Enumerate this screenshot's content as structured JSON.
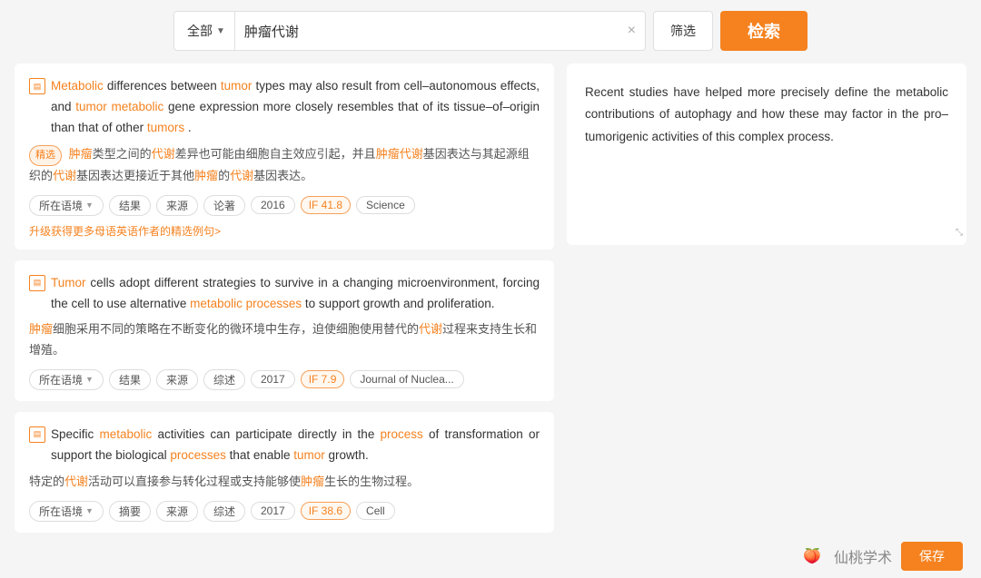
{
  "search": {
    "select_label": "全部",
    "query": "肿瘤代谢",
    "clear_icon": "×",
    "filter_label": "筛选",
    "search_label": "检索"
  },
  "results": [
    {
      "id": 1,
      "en_parts": [
        {
          "text": "Metabolic",
          "type": "orange"
        },
        {
          "text": " differences between ",
          "type": "normal"
        },
        {
          "text": "tumor",
          "type": "orange"
        },
        {
          "text": " types may also result from cell–autonomous effects, and ",
          "type": "normal"
        },
        {
          "text": "tumor",
          "type": "orange"
        },
        {
          "text": " ",
          "type": "normal"
        },
        {
          "text": "metabolic",
          "type": "orange"
        },
        {
          "text": " gene expression more closely resembles that of its tissue–of–origin than that of other ",
          "type": "normal"
        },
        {
          "text": "tumors",
          "type": "orange"
        },
        {
          "text": ".",
          "type": "normal"
        }
      ],
      "zh_prefix": "精选",
      "zh_text": "肿瘤类型之间的代谢差异也可能由细胞自主效应引起，并且肿瘤代谢基因表达与其起源组织的代谢基因表达更接近于其他肿瘤的代谢基因表达。",
      "zh_highlights": [
        "肿瘤",
        "代谢",
        "肿瘤代谢",
        "代谢",
        "肿瘤",
        "代谢"
      ],
      "tags": [
        {
          "label": "所在语境",
          "type": "dropdown"
        },
        {
          "label": "结果",
          "type": "normal"
        },
        {
          "label": "来源",
          "type": "normal"
        },
        {
          "label": "论著",
          "type": "normal"
        },
        {
          "label": "2016",
          "type": "normal"
        },
        {
          "label": "IF 41.8",
          "type": "if"
        },
        {
          "label": "Science",
          "type": "normal"
        }
      ],
      "upgrade_link": "升级获得更多母语英语作者的精选例句>"
    },
    {
      "id": 2,
      "en_parts": [
        {
          "text": "Tumor",
          "type": "orange"
        },
        {
          "text": " cells adopt different strategies to survive in a changing microenvironment, forcing the cell to use alternative ",
          "type": "normal"
        },
        {
          "text": "metabolic processes",
          "type": "orange"
        },
        {
          "text": " to support growth and proliferation.",
          "type": "normal"
        }
      ],
      "zh_text": "肿瘤细胞采用不同的策略在不断变化的微环境中生存，迫使细胞使用替代的代谢过程来支持生长和增殖。",
      "zh_highlights": [
        "肿瘤",
        "代谢"
      ],
      "tags": [
        {
          "label": "所在语境",
          "type": "dropdown"
        },
        {
          "label": "结果",
          "type": "normal"
        },
        {
          "label": "来源",
          "type": "normal"
        },
        {
          "label": "综述",
          "type": "normal"
        },
        {
          "label": "2017",
          "type": "normal"
        },
        {
          "label": "IF 7.9",
          "type": "if"
        },
        {
          "label": "Journal of Nuclea...",
          "type": "normal"
        }
      ]
    },
    {
      "id": 3,
      "en_parts": [
        {
          "text": "Specific ",
          "type": "normal"
        },
        {
          "text": "metabolic",
          "type": "orange"
        },
        {
          "text": " activities can participate directly in the ",
          "type": "normal"
        },
        {
          "text": "process",
          "type": "orange"
        },
        {
          "text": " of transformation or support the biological ",
          "type": "normal"
        },
        {
          "text": "processes",
          "type": "orange"
        },
        {
          "text": " that enable ",
          "type": "normal"
        },
        {
          "text": "tumor",
          "type": "orange"
        },
        {
          "text": " growth.",
          "type": "normal"
        }
      ],
      "zh_text": "特定的代谢活动可以直接参与转化过程或支持能够使肿瘤生长的生物过程。",
      "zh_highlights": [
        "代谢",
        "肿瘤"
      ],
      "tags": [
        {
          "label": "所在语境",
          "type": "dropdown"
        },
        {
          "label": "摘要",
          "type": "normal"
        },
        {
          "label": "来源",
          "type": "normal"
        },
        {
          "label": "综述",
          "type": "normal"
        },
        {
          "label": "2017",
          "type": "normal"
        },
        {
          "label": "IF 38.6",
          "type": "if"
        },
        {
          "label": "Cell",
          "type": "normal"
        }
      ]
    }
  ],
  "preview": {
    "text": "Recent studies have helped more precisely define the metabolic contributions of autophagy and how these may factor in the pro–tumorigenic activities of this complex process."
  },
  "brand": {
    "name": "仙桃学术",
    "save_label": "保存"
  }
}
